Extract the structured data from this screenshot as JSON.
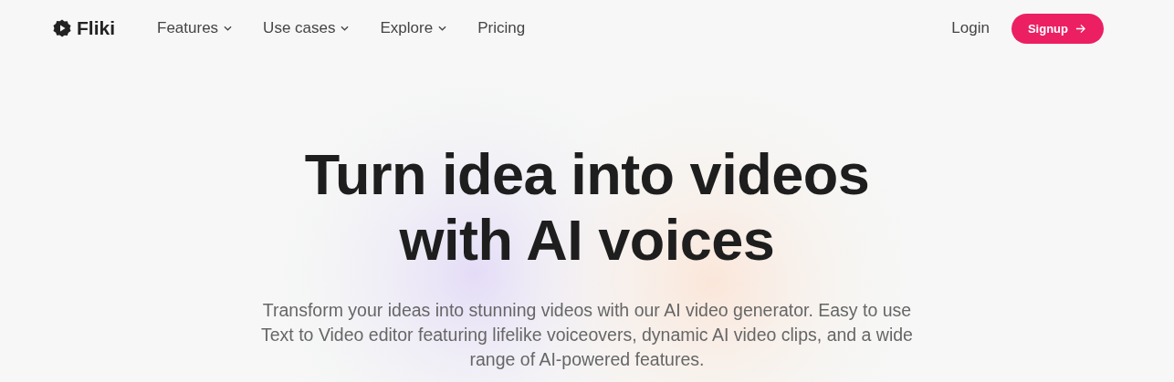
{
  "brand": {
    "name": "Fliki"
  },
  "nav": [
    {
      "label": "Features",
      "has_menu": true
    },
    {
      "label": "Use cases",
      "has_menu": true
    },
    {
      "label": "Explore",
      "has_menu": true
    },
    {
      "label": "Pricing",
      "has_menu": false
    }
  ],
  "login": "Login",
  "signup": "Signup",
  "hero": {
    "title": "Turn idea into videos with AI voices",
    "subtitle": "Transform your ideas into stunning videos with our AI video generator. Easy to use Text to Video editor featuring lifelike voiceovers, dynamic AI video clips, and a wide range of AI-powered features."
  }
}
